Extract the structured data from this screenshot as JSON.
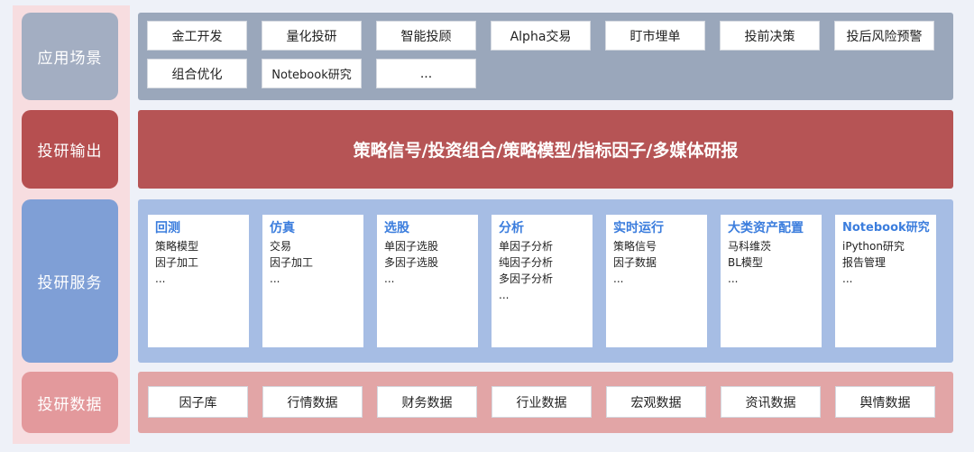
{
  "rows": {
    "scenarios": {
      "label": "应用场景",
      "items": [
        "金工开发",
        "量化投研",
        "智能投顾",
        "Alpha交易",
        "盯市埋单",
        "投前决策",
        "投后风险预警",
        "组合优化",
        "Notebook研究",
        "..."
      ]
    },
    "output": {
      "label": "投研输出",
      "text": "策略信号/投资组合/策略模型/指标因子/多媒体研报"
    },
    "services": {
      "label": "投研服务",
      "cards": [
        {
          "title": "回测",
          "items": [
            "策略模型",
            "因子加工",
            "..."
          ]
        },
        {
          "title": "仿真",
          "items": [
            "交易",
            "因子加工",
            "..."
          ]
        },
        {
          "title": "选股",
          "items": [
            "单因子选股",
            "多因子选股",
            "..."
          ]
        },
        {
          "title": "分析",
          "items": [
            "单因子分析",
            "纯因子分析",
            "多因子分析",
            "..."
          ]
        },
        {
          "title": "实时运行",
          "items": [
            "策略信号",
            "因子数据",
            "..."
          ]
        },
        {
          "title": "大类资产配置",
          "items": [
            "马科维茨",
            "BL模型",
            "..."
          ]
        },
        {
          "title": "Notebook研究",
          "items": [
            "iPython研究",
            "报告管理",
            "..."
          ]
        }
      ]
    },
    "data": {
      "label": "投研数据",
      "items": [
        "因子库",
        "行情数据",
        "财务数据",
        "行业数据",
        "宏观数据",
        "资讯数据",
        "舆情数据"
      ]
    }
  },
  "colors": {
    "scenario_label": "#a3aec2",
    "scenario_panel": "#9aa7bb",
    "output_label": "#b64f50",
    "output_panel": "#b65455",
    "service_label": "#7f9fd6",
    "service_panel": "#a6bde4",
    "data_label": "#e3999c",
    "data_panel": "#e2a5a6",
    "card_title": "#3b7ddd"
  }
}
